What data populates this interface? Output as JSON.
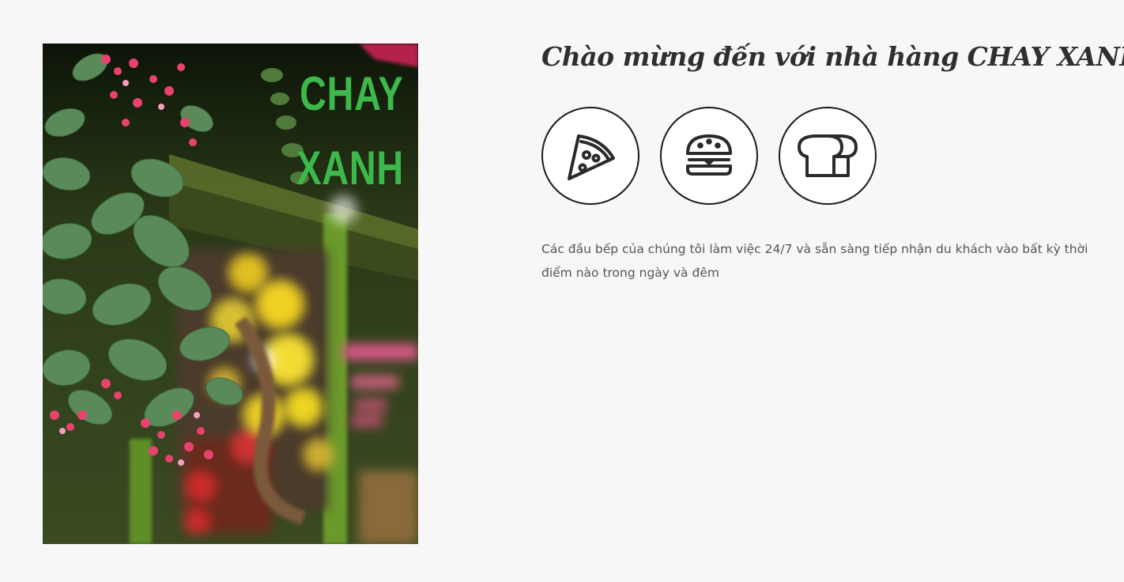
{
  "photo": {
    "sign_line1": "CHAY",
    "sign_line2": "XANH"
  },
  "heading": "Chào mừng đến với nhà hàng CHAY XANH",
  "icons": [
    {
      "name": "pizza-icon"
    },
    {
      "name": "burger-icon"
    },
    {
      "name": "bread-icon"
    }
  ],
  "description": "Các đầu bếp của chúng tôi làm việc 24/7 và sẵn sàng tiếp nhận du khách vào bất kỳ thời điểm nào trong ngày và đêm",
  "colors": {
    "background": "#f7f7f7",
    "heading": "#2f2f2f",
    "body_text": "#555555",
    "sign_green": "#3db84a"
  }
}
